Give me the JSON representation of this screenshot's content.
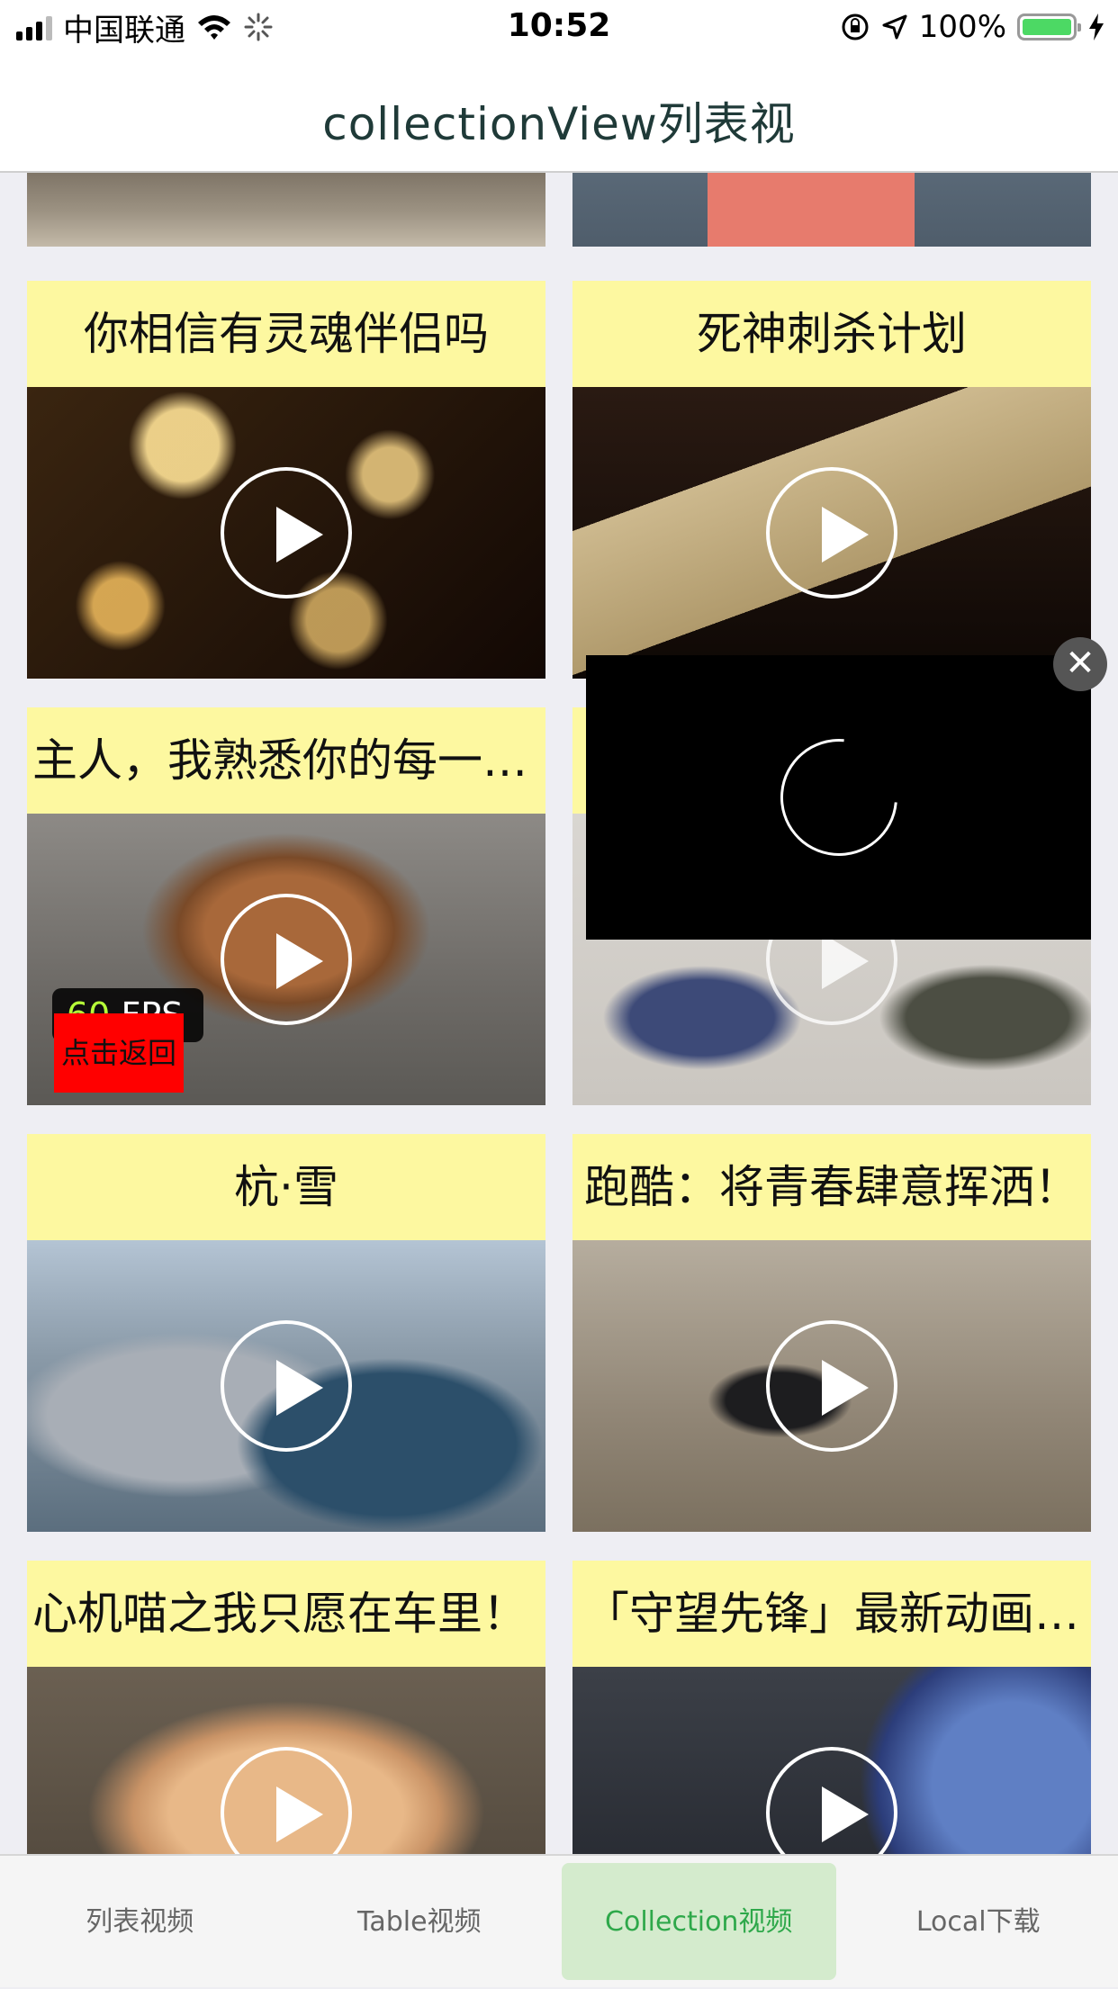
{
  "status_bar": {
    "carrier": "中国联通",
    "time": "10:52",
    "battery": "100%",
    "wifi_icon": "wifi-icon",
    "activity_icon": "activity-spinner-icon",
    "lock_icon": "orientation-lock-icon",
    "location_icon": "location-arrow-icon",
    "charging_icon": "lightning-icon"
  },
  "nav": {
    "title": "collectionView列表视"
  },
  "cells": [
    {
      "title": "你相信有灵魂伴侣吗"
    },
    {
      "title": "死神刺杀计划"
    },
    {
      "title": "主人，我熟悉你的每一…"
    },
    {
      "title": ""
    },
    {
      "title": "杭·雪"
    },
    {
      "title": "跑酷：将青春肆意挥洒！"
    },
    {
      "title": "心机喵之我只愿在车里！"
    },
    {
      "title": "「守望先锋」最新动画…"
    }
  ],
  "fps": {
    "value": "60",
    "unit": "FPS"
  },
  "back_button": {
    "label": "点击返回"
  },
  "overlay": {
    "close_symbol": "✕"
  },
  "tab_bar": {
    "tabs": [
      {
        "label": "列表视频"
      },
      {
        "label": "Table视频"
      },
      {
        "label": "Collection视频"
      },
      {
        "label": "Local下载"
      }
    ],
    "selected_index": 2
  },
  "colors": {
    "title_bg": "#fdf8a0",
    "accent_green": "#2ea84a",
    "selected_tab_bg": "#d4ebcd",
    "back_button": "#ff0000",
    "battery": "#4cd964"
  }
}
